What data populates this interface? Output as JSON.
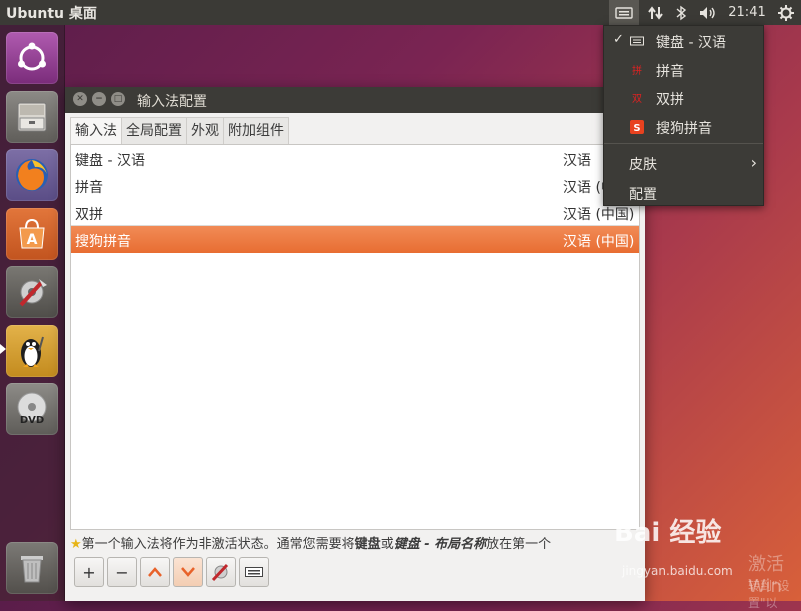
{
  "topbar": {
    "title": "Ubuntu 桌面",
    "time": "21:41"
  },
  "launcher": {
    "items": [
      "ubuntu-home-icon",
      "file-cabinet-icon",
      "firefox-icon",
      "software-center-icon",
      "system-settings-icon",
      "linux-penguin-icon",
      "dvd-icon",
      "trash-icon"
    ]
  },
  "window": {
    "title": "输入法配置",
    "tabs": [
      "输入法",
      "全局配置",
      "外观",
      "附加组件"
    ],
    "rows": [
      {
        "name": "键盘 - 汉语",
        "lang": "汉语"
      },
      {
        "name": "拼音",
        "lang": "汉语 (中"
      },
      {
        "name": "双拼",
        "lang": "汉语 (中国)"
      },
      {
        "name": "搜狗拼音",
        "lang": "汉语 (中国)"
      }
    ],
    "notice": {
      "part1": "第一个输入法将作为非激活状态。通常您需要将",
      "bold1": "键盘",
      "part2": "或",
      "bold2": "键盘 - 布局名称",
      "part3": "放在第一个"
    },
    "toolbar": {
      "add": "+",
      "remove": "−"
    }
  },
  "menu": {
    "items": [
      {
        "label": "键盘 - 汉语",
        "checked": "✓"
      },
      {
        "label": "拼音"
      },
      {
        "label": "双拼"
      },
      {
        "label": "搜狗拼音"
      }
    ],
    "skin": "皮肤",
    "config": "配置"
  },
  "watermark": {
    "brand": "Bai 经验",
    "url": "jingyan.baidu.com",
    "win1": "激活 Win",
    "win2": "转到\"设置\"以"
  },
  "colors": {
    "selected": "#e86d32",
    "panel": "#3b3a36"
  }
}
